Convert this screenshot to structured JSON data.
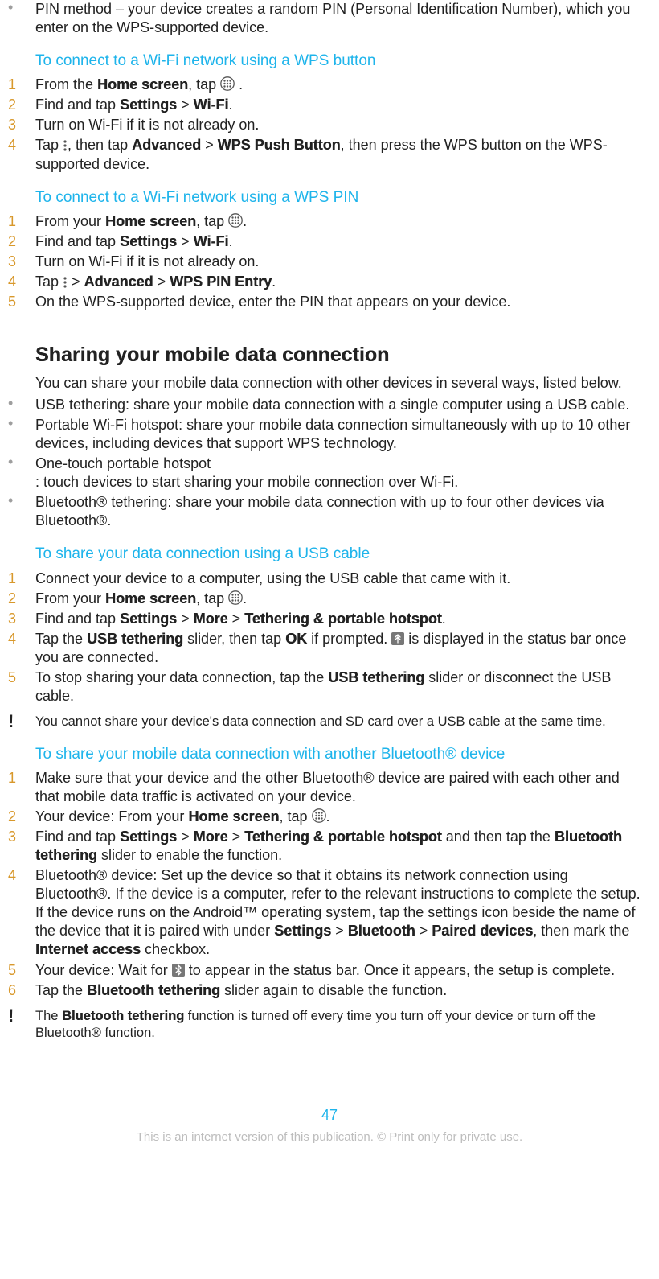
{
  "intro_bullet": "PIN method – your device creates a random PIN (Personal Identification Number), which you enter on the WPS-supported device.",
  "h_wps_button": "To connect to a Wi-Fi network using a WPS button",
  "wps_button_steps": {
    "s1a": "From the ",
    "s1b": "Home screen",
    "s1c": ", tap ",
    "s1d": " .",
    "s2a": "Find and tap ",
    "s2b": "Settings",
    "s2c": " > ",
    "s2d": "Wi-Fi",
    "s2e": ".",
    "s3": "Turn on Wi-Fi if it is not already on.",
    "s4a": "Tap ",
    "s4b": ", then tap ",
    "s4c": "Advanced",
    "s4d": " > ",
    "s4e": "WPS Push Button",
    "s4f": ", then press the WPS button on the WPS-supported device."
  },
  "h_wps_pin": "To connect to a Wi-Fi network using a WPS PIN",
  "wps_pin_steps": {
    "s1a": "From your ",
    "s1b": "Home screen",
    "s1c": ", tap ",
    "s1d": ".",
    "s2a": "Find and tap ",
    "s2b": "Settings",
    "s2c": " > ",
    "s2d": "Wi-Fi",
    "s2e": ".",
    "s3": "Turn on Wi-Fi if it is not already on.",
    "s4a": "Tap ",
    "s4b": " > ",
    "s4c": "Advanced",
    "s4d": " > ",
    "s4e": "WPS PIN Entry",
    "s4f": ".",
    "s5": "On the WPS-supported device, enter the PIN that appears on your device."
  },
  "h_sharing": "Sharing your mobile data connection",
  "sharing_intro": "You can share your mobile data connection with other devices in several ways, listed below.",
  "sharing_bullets": {
    "b1": "USB tethering: share your mobile data connection with a single computer using a USB cable.",
    "b2": "Portable Wi-Fi hotspot: share your mobile data connection simultaneously with up to 10 other devices, including devices that support WPS technology.",
    "b3a": "One-touch portable hotspot",
    "b3b": ": touch devices to start sharing your mobile connection over Wi-Fi.",
    "b4": "Bluetooth® tethering: share your mobile data connection with up to four other devices via Bluetooth®."
  },
  "h_usb": "To share your data connection using a USB cable",
  "usb_steps": {
    "s1": "Connect your device to a computer, using the USB cable that came with it.",
    "s2a": "From your ",
    "s2b": "Home screen",
    "s2c": ", tap ",
    "s2d": ".",
    "s3a": "Find and tap ",
    "s3b": "Settings",
    "s3c": " > ",
    "s3d": "More",
    "s3e": " > ",
    "s3f": "Tethering & portable hotspot",
    "s3g": ".",
    "s4a": "Tap the ",
    "s4b": "USB tethering",
    "s4c": " slider, then tap ",
    "s4d": "OK",
    "s4e": " if prompted. ",
    "s4f": " is displayed in the status bar once you are connected.",
    "s5a": "To stop sharing your data connection, tap the ",
    "s5b": "USB tethering",
    "s5c": " slider or disconnect the USB cable."
  },
  "usb_note": "You cannot share your device's data connection and SD card over a USB cable at the same time.",
  "h_bt": "To share your mobile data connection with another Bluetooth® device",
  "bt_steps": {
    "s1": "Make sure that your device and the other Bluetooth® device are paired with each other and that mobile data traffic is activated on your device.",
    "s2a": "Your device: From your ",
    "s2b": "Home screen",
    "s2c": ", tap ",
    "s2d": ".",
    "s3a": "Find and tap ",
    "s3b": "Settings",
    "s3c": " > ",
    "s3d": "More",
    "s3e": " > ",
    "s3f": "Tethering & portable hotspot",
    "s3g": " and then tap the ",
    "s3h": "Bluetooth tethering",
    "s3i": " slider to enable the function.",
    "s4a": "Bluetooth® device: Set up the device so that it obtains its network connection using Bluetooth®. If the device is a computer, refer to the relevant instructions to complete the setup. If the device runs on the Android™ operating system, tap the settings icon beside the name of the device that it is paired with under ",
    "s4b": "Settings",
    "s4c": " > ",
    "s4d": "Bluetooth",
    "s4e": " > ",
    "s4f": "Paired devices",
    "s4g": ", then mark the ",
    "s4h": "Internet access",
    "s4i": " checkbox.",
    "s5a": "Your device: Wait for ",
    "s5b": " to appear in the status bar. Once it appears, the setup is complete.",
    "s6a": "Tap the ",
    "s6b": "Bluetooth tethering",
    "s6c": " slider again to disable the function."
  },
  "bt_note_a": "The ",
  "bt_note_b": "Bluetooth tethering",
  "bt_note_c": " function is turned off every time you turn off your device or turn off the Bluetooth® function.",
  "page_number": "47",
  "footer": "This is an internet version of this publication. © Print only for private use.",
  "nums": {
    "n1": "1",
    "n2": "2",
    "n3": "3",
    "n4": "4",
    "n5": "5",
    "n6": "6"
  },
  "bullet": "•",
  "exclaim": "!"
}
